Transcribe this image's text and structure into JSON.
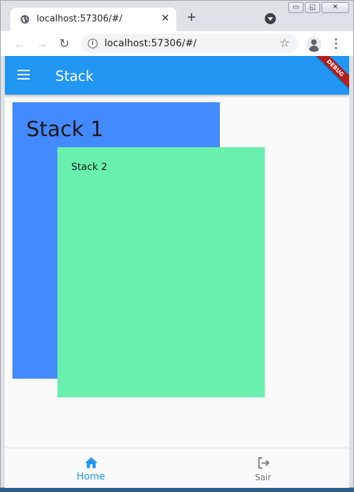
{
  "browser": {
    "tab_title": "localhost:57306/#/",
    "tab_close": "✕",
    "new_tab": "+",
    "url": "localhost:57306/#/",
    "win_minimize": "▭",
    "win_restore": "◱",
    "win_close": "✕",
    "back_icon": "←",
    "forward_icon": "→",
    "reload_icon": "↻",
    "info_icon": "i",
    "star_icon": "☆",
    "menu_icon": "⋮"
  },
  "app": {
    "title": "Stack",
    "debug_label": "DEBUG",
    "colors": {
      "appbar": "#2196f3",
      "stack1": "#448aff",
      "stack2": "#69f0ae"
    }
  },
  "content": {
    "stack1_label": "Stack 1",
    "stack2_label": "Stack 2"
  },
  "bottom_nav": {
    "items": [
      {
        "label": "Home",
        "icon": "home-icon",
        "selected": true
      },
      {
        "label": "Sair",
        "icon": "logout-icon",
        "selected": false
      }
    ]
  }
}
